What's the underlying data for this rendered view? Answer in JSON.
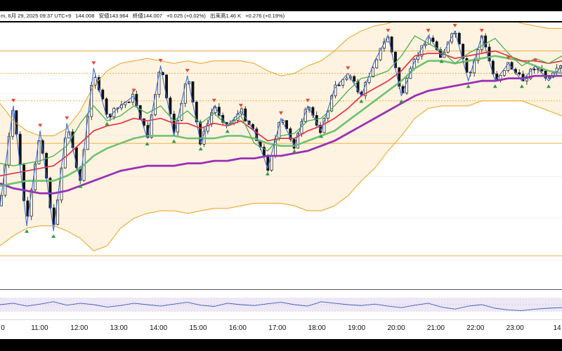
{
  "header": {
    "title_fragment": "m, 6月 29, 2025 09:37 UTC+9",
    "stats": [
      "144.008",
      "安値143.964",
      "終値144.007",
      "+0.025 (+0.02%)",
      "出来高1.46 K",
      "+0.276 (+0.19%)"
    ]
  },
  "chart_data": {
    "type": "line",
    "x_ticks": [
      "0",
      "11:00",
      "12:00",
      "13:00",
      "14:00",
      "15:00",
      "16:00",
      "17:00",
      "18:00",
      "19:00",
      "20:00",
      "21:00",
      "22:00",
      "23:00",
      "14"
    ],
    "series": [
      {
        "values": [
          0.53,
          0.54,
          0.53,
          0.52,
          0.5,
          0.46,
          0.37,
          0.3,
          0.36,
          0.34,
          0.3,
          0.33,
          0.3,
          0.36,
          0.32,
          0.37,
          0.33,
          0.38,
          0.34,
          0.45,
          0.48,
          0.42,
          0.41,
          0.36,
          0.35,
          0.3,
          0.24,
          0.19,
          0.18,
          0.16,
          0.1,
          0.02,
          0.05,
          0.08,
          0.13,
          0.09,
          0.06,
          0.03,
          0.09,
          0.14,
          0.11,
          0.13,
          0.1
        ]
      },
      {
        "values": [
          0.58,
          0.57,
          0.56,
          0.55,
          0.54,
          0.5,
          0.45,
          0.4,
          0.38,
          0.37,
          0.35,
          0.36,
          0.35,
          0.37,
          0.37,
          0.39,
          0.37,
          0.38,
          0.36,
          0.4,
          0.44,
          0.43,
          0.43,
          0.4,
          0.38,
          0.35,
          0.31,
          0.26,
          0.23,
          0.2,
          0.16,
          0.1,
          0.09,
          0.09,
          0.11,
          0.1,
          0.09,
          0.08,
          0.1,
          0.12,
          0.12,
          0.13,
          0.12
        ]
      },
      {
        "values": [
          0.62,
          0.61,
          0.6,
          0.6,
          0.6,
          0.58,
          0.55,
          0.5,
          0.47,
          0.45,
          0.43,
          0.42,
          0.42,
          0.42,
          0.43,
          0.43,
          0.43,
          0.42,
          0.42,
          0.43,
          0.45,
          0.46,
          0.46,
          0.44,
          0.42,
          0.4,
          0.36,
          0.32,
          0.28,
          0.24,
          0.2,
          0.15,
          0.12,
          0.12,
          0.13,
          0.12,
          0.11,
          0.1,
          0.11,
          0.12,
          0.14,
          0.16,
          0.17
        ]
      },
      {
        "values": [
          0.61,
          0.63,
          0.64,
          0.65,
          0.65,
          0.64,
          0.62,
          0.6,
          0.58,
          0.56,
          0.55,
          0.54,
          0.54,
          0.54,
          0.53,
          0.53,
          0.52,
          0.52,
          0.51,
          0.51,
          0.5,
          0.5,
          0.49,
          0.48,
          0.46,
          0.44,
          0.41,
          0.38,
          0.35,
          0.32,
          0.29,
          0.26,
          0.24,
          0.23,
          0.22,
          0.21,
          0.2,
          0.2,
          0.19,
          0.19,
          0.18,
          0.18,
          0.18
        ]
      },
      {
        "values": [
          0.53,
          0.54,
          0.55,
          0.56,
          0.56,
          0.57,
          0.57,
          0.57,
          0.57,
          0.57,
          0.57,
          0.57,
          0.56,
          0.56,
          0.55,
          0.55,
          0.55,
          0.54,
          0.54,
          0.54,
          0.53,
          0.53,
          0.52,
          0.51,
          0.5,
          0.48,
          0.46,
          0.44,
          0.42,
          0.4,
          0.38,
          0.36,
          0.35,
          0.34,
          0.33,
          0.32,
          0.31,
          0.3,
          0.3,
          0.29,
          0.28,
          0.27,
          0.27
        ]
      },
      {
        "values": [
          0.29,
          0.36,
          0.4,
          0.42,
          0.42,
          0.39,
          0.32,
          0.22,
          0.16,
          0.13,
          0.12,
          0.11,
          0.12,
          0.13,
          0.12,
          0.13,
          0.12,
          0.12,
          0.12,
          0.13,
          0.16,
          0.18,
          0.17,
          0.14,
          0.12,
          0.08,
          0.03,
          0.0,
          -0.02,
          -0.03,
          -0.05,
          -0.08,
          -0.08,
          -0.08,
          -0.05,
          -0.05,
          -0.08,
          -0.08,
          -0.05,
          -0.03,
          -0.02,
          -0.01,
          -0.01
        ]
      },
      {
        "values": [
          0.86,
          0.82,
          0.79,
          0.78,
          0.78,
          0.8,
          0.83,
          0.88,
          0.86,
          0.79,
          0.75,
          0.73,
          0.72,
          0.72,
          0.73,
          0.72,
          0.71,
          0.71,
          0.7,
          0.69,
          0.69,
          0.69,
          0.7,
          0.72,
          0.72,
          0.7,
          0.66,
          0.6,
          0.55,
          0.48,
          0.42,
          0.35,
          0.31,
          0.3,
          0.3,
          0.3,
          0.28,
          0.28,
          0.28,
          0.28,
          0.3,
          0.32,
          0.34
        ]
      },
      {
        "values": [
          0.7,
          0.3,
          0.78,
          0.4,
          0.8,
          0.37,
          0.6,
          0.15,
          0.35,
          0.3,
          0.26,
          0.43,
          0.14,
          0.42,
          0.18,
          0.45,
          0.3,
          0.38,
          0.32,
          0.4,
          0.55,
          0.35,
          0.46,
          0.3,
          0.4,
          0.23,
          0.17,
          0.26,
          0.12,
          0.02,
          0.26,
          0.12,
          0.02,
          0.1,
          0.0,
          0.2,
          0.02,
          0.2,
          0.13,
          0.2,
          0.14,
          0.2,
          0.14
        ]
      }
    ],
    "colors": {
      "bollinger": "#f0a830",
      "bollinger_fill": "#fdf3e0",
      "ma_short": "#4caf50",
      "ma_mid": "#e83248",
      "ma_long": "#6fc16f",
      "ma_longest": "#9c2fb5",
      "zigzag": "#3b6ddb",
      "candle": "#111111",
      "signal_up": "#2e9b4a",
      "signal_down": "#e8453c",
      "level_line": "#f0a830",
      "grid_line": "#e6e6e6"
    }
  },
  "oscillator": {
    "series": [
      0.5,
      0.55,
      0.45,
      0.52,
      0.6,
      0.48,
      0.55,
      0.5,
      0.42,
      0.47,
      0.55,
      0.5,
      0.45,
      0.52,
      0.58,
      0.48,
      0.44,
      0.55,
      0.5,
      0.47,
      0.53,
      0.58,
      0.5,
      0.45,
      0.6,
      0.55,
      0.5,
      0.47,
      0.52,
      0.45,
      0.4,
      0.48,
      0.55,
      0.42,
      0.35,
      0.45,
      0.5,
      0.38,
      0.32,
      0.3,
      0.35,
      0.38,
      0.4
    ],
    "colors": {
      "line": "#3b5cb8",
      "fill": "#ede7f6",
      "ref": "#bbbbbb"
    }
  }
}
